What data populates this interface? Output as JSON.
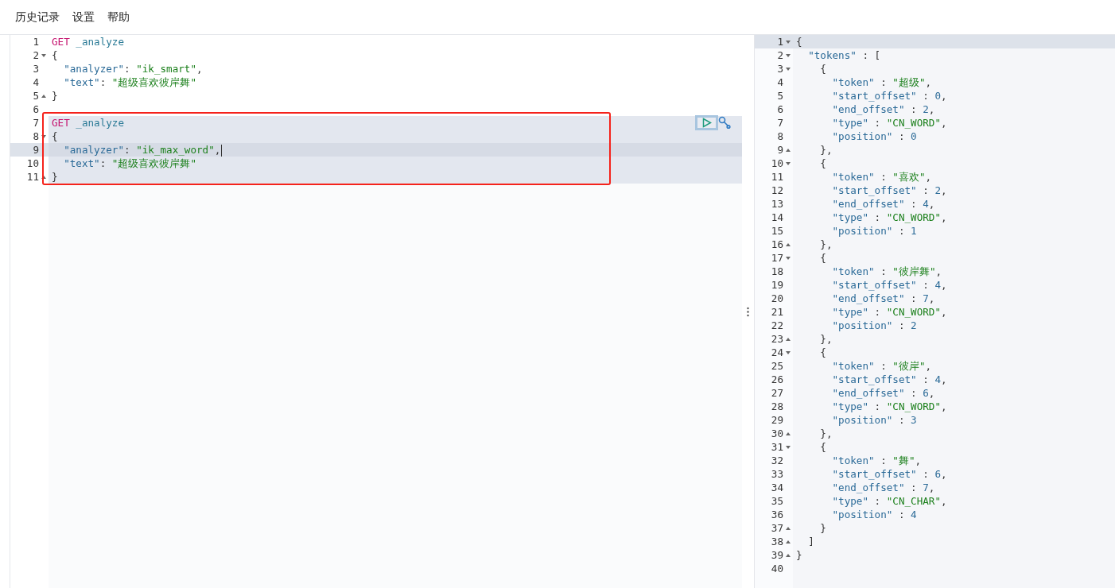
{
  "menu": [
    "历史记录",
    "设置",
    "帮助"
  ],
  "request_editor": {
    "annotation_box": true,
    "lines": [
      {
        "number": "1",
        "fold_start": false,
        "fold_end": false,
        "cursor": false,
        "in_request": false,
        "tokens": [
          {
            "kind": "method",
            "text": "GET"
          },
          {
            "kind": "path",
            "text": " _analyze"
          }
        ]
      },
      {
        "number": "2",
        "fold_start": true,
        "fold_end": false,
        "cursor": false,
        "in_request": false,
        "tokens": [
          {
            "kind": "punct",
            "text": "{"
          }
        ]
      },
      {
        "number": "3",
        "fold_start": false,
        "fold_end": false,
        "cursor": false,
        "in_request": false,
        "tokens": [
          {
            "kind": "key",
            "text": "  \"analyzer\""
          },
          {
            "kind": "punct",
            "text": ": "
          },
          {
            "kind": "string",
            "text": "\"ik_smart\""
          },
          {
            "kind": "punct",
            "text": ","
          }
        ]
      },
      {
        "number": "4",
        "fold_start": false,
        "fold_end": false,
        "cursor": false,
        "in_request": false,
        "tokens": [
          {
            "kind": "key",
            "text": "  \"text\""
          },
          {
            "kind": "punct",
            "text": ": "
          },
          {
            "kind": "string",
            "text": "\"超级喜欢彼岸舞\""
          }
        ]
      },
      {
        "number": "5",
        "fold_start": false,
        "fold_end": true,
        "cursor": false,
        "in_request": false,
        "tokens": [
          {
            "kind": "punct",
            "text": "}"
          }
        ]
      },
      {
        "number": "6",
        "fold_start": false,
        "fold_end": false,
        "cursor": false,
        "in_request": false
      },
      {
        "number": "7",
        "fold_start": false,
        "fold_end": false,
        "cursor": false,
        "in_request": true,
        "tokens": [
          {
            "kind": "method",
            "text": "GET"
          },
          {
            "kind": "path",
            "text": " _analyze"
          }
        ]
      },
      {
        "number": "8",
        "fold_start": true,
        "fold_end": false,
        "cursor": false,
        "in_request": true,
        "tokens": [
          {
            "kind": "punct",
            "text": "{"
          }
        ]
      },
      {
        "number": "9",
        "fold_start": false,
        "fold_end": false,
        "cursor": true,
        "in_request": true,
        "tokens": [
          {
            "kind": "key",
            "text": "  \"analyzer\""
          },
          {
            "kind": "punct",
            "text": ": "
          },
          {
            "kind": "string",
            "text": "\"ik_max_word\""
          },
          {
            "kind": "punct",
            "text": ","
          }
        ]
      },
      {
        "number": "10",
        "fold_start": false,
        "fold_end": false,
        "cursor": false,
        "in_request": true,
        "tokens": [
          {
            "kind": "key",
            "text": "  \"text\""
          },
          {
            "kind": "punct",
            "text": ": "
          },
          {
            "kind": "string",
            "text": "\"超级喜欢彼岸舞\""
          }
        ]
      },
      {
        "number": "11",
        "fold_start": false,
        "fold_end": true,
        "cursor": false,
        "in_request": true,
        "tokens": [
          {
            "kind": "punct",
            "text": "}"
          }
        ]
      }
    ]
  },
  "response_viewer": {
    "lines": [
      {
        "number": "1",
        "fold_start": true,
        "fold_end": false,
        "cursor": true,
        "tokens": [
          {
            "kind": "punct",
            "text": "{"
          }
        ]
      },
      {
        "number": "2",
        "fold_start": true,
        "fold_end": false,
        "cursor": false,
        "tokens": [
          {
            "kind": "key",
            "text": "  \"tokens\""
          },
          {
            "kind": "punct",
            "text": " : ["
          }
        ]
      },
      {
        "number": "3",
        "fold_start": true,
        "fold_end": false,
        "cursor": false,
        "tokens": [
          {
            "kind": "punct",
            "text": "    {"
          }
        ]
      },
      {
        "number": "4",
        "fold_start": false,
        "fold_end": false,
        "cursor": false,
        "tokens": [
          {
            "kind": "key",
            "text": "      \"token\""
          },
          {
            "kind": "punct",
            "text": " : "
          },
          {
            "kind": "string",
            "text": "\"超级\""
          },
          {
            "kind": "punct",
            "text": ","
          }
        ]
      },
      {
        "number": "5",
        "fold_start": false,
        "fold_end": false,
        "cursor": false,
        "tokens": [
          {
            "kind": "key",
            "text": "      \"start_offset\""
          },
          {
            "kind": "punct",
            "text": " : "
          },
          {
            "kind": "number",
            "text": "0"
          },
          {
            "kind": "punct",
            "text": ","
          }
        ]
      },
      {
        "number": "6",
        "fold_start": false,
        "fold_end": false,
        "cursor": false,
        "tokens": [
          {
            "kind": "key",
            "text": "      \"end_offset\""
          },
          {
            "kind": "punct",
            "text": " : "
          },
          {
            "kind": "number",
            "text": "2"
          },
          {
            "kind": "punct",
            "text": ","
          }
        ]
      },
      {
        "number": "7",
        "fold_start": false,
        "fold_end": false,
        "cursor": false,
        "tokens": [
          {
            "kind": "key",
            "text": "      \"type\""
          },
          {
            "kind": "punct",
            "text": " : "
          },
          {
            "kind": "string",
            "text": "\"CN_WORD\""
          },
          {
            "kind": "punct",
            "text": ","
          }
        ]
      },
      {
        "number": "8",
        "fold_start": false,
        "fold_end": false,
        "cursor": false,
        "tokens": [
          {
            "kind": "key",
            "text": "      \"position\""
          },
          {
            "kind": "punct",
            "text": " : "
          },
          {
            "kind": "number",
            "text": "0"
          }
        ]
      },
      {
        "number": "9",
        "fold_start": false,
        "fold_end": true,
        "cursor": false,
        "tokens": [
          {
            "kind": "punct",
            "text": "    },"
          }
        ]
      },
      {
        "number": "10",
        "fold_start": true,
        "fold_end": false,
        "cursor": false,
        "tokens": [
          {
            "kind": "punct",
            "text": "    {"
          }
        ]
      },
      {
        "number": "11",
        "fold_start": false,
        "fold_end": false,
        "cursor": false,
        "tokens": [
          {
            "kind": "key",
            "text": "      \"token\""
          },
          {
            "kind": "punct",
            "text": " : "
          },
          {
            "kind": "string",
            "text": "\"喜欢\""
          },
          {
            "kind": "punct",
            "text": ","
          }
        ]
      },
      {
        "number": "12",
        "fold_start": false,
        "fold_end": false,
        "cursor": false,
        "tokens": [
          {
            "kind": "key",
            "text": "      \"start_offset\""
          },
          {
            "kind": "punct",
            "text": " : "
          },
          {
            "kind": "number",
            "text": "2"
          },
          {
            "kind": "punct",
            "text": ","
          }
        ]
      },
      {
        "number": "13",
        "fold_start": false,
        "fold_end": false,
        "cursor": false,
        "tokens": [
          {
            "kind": "key",
            "text": "      \"end_offset\""
          },
          {
            "kind": "punct",
            "text": " : "
          },
          {
            "kind": "number",
            "text": "4"
          },
          {
            "kind": "punct",
            "text": ","
          }
        ]
      },
      {
        "number": "14",
        "fold_start": false,
        "fold_end": false,
        "cursor": false,
        "tokens": [
          {
            "kind": "key",
            "text": "      \"type\""
          },
          {
            "kind": "punct",
            "text": " : "
          },
          {
            "kind": "string",
            "text": "\"CN_WORD\""
          },
          {
            "kind": "punct",
            "text": ","
          }
        ]
      },
      {
        "number": "15",
        "fold_start": false,
        "fold_end": false,
        "cursor": false,
        "tokens": [
          {
            "kind": "key",
            "text": "      \"position\""
          },
          {
            "kind": "punct",
            "text": " : "
          },
          {
            "kind": "number",
            "text": "1"
          }
        ]
      },
      {
        "number": "16",
        "fold_start": false,
        "fold_end": true,
        "cursor": false,
        "tokens": [
          {
            "kind": "punct",
            "text": "    },"
          }
        ]
      },
      {
        "number": "17",
        "fold_start": true,
        "fold_end": false,
        "cursor": false,
        "tokens": [
          {
            "kind": "punct",
            "text": "    {"
          }
        ]
      },
      {
        "number": "18",
        "fold_start": false,
        "fold_end": false,
        "cursor": false,
        "tokens": [
          {
            "kind": "key",
            "text": "      \"token\""
          },
          {
            "kind": "punct",
            "text": " : "
          },
          {
            "kind": "string",
            "text": "\"彼岸舞\""
          },
          {
            "kind": "punct",
            "text": ","
          }
        ]
      },
      {
        "number": "19",
        "fold_start": false,
        "fold_end": false,
        "cursor": false,
        "tokens": [
          {
            "kind": "key",
            "text": "      \"start_offset\""
          },
          {
            "kind": "punct",
            "text": " : "
          },
          {
            "kind": "number",
            "text": "4"
          },
          {
            "kind": "punct",
            "text": ","
          }
        ]
      },
      {
        "number": "20",
        "fold_start": false,
        "fold_end": false,
        "cursor": false,
        "tokens": [
          {
            "kind": "key",
            "text": "      \"end_offset\""
          },
          {
            "kind": "punct",
            "text": " : "
          },
          {
            "kind": "number",
            "text": "7"
          },
          {
            "kind": "punct",
            "text": ","
          }
        ]
      },
      {
        "number": "21",
        "fold_start": false,
        "fold_end": false,
        "cursor": false,
        "tokens": [
          {
            "kind": "key",
            "text": "      \"type\""
          },
          {
            "kind": "punct",
            "text": " : "
          },
          {
            "kind": "string",
            "text": "\"CN_WORD\""
          },
          {
            "kind": "punct",
            "text": ","
          }
        ]
      },
      {
        "number": "22",
        "fold_start": false,
        "fold_end": false,
        "cursor": false,
        "tokens": [
          {
            "kind": "key",
            "text": "      \"position\""
          },
          {
            "kind": "punct",
            "text": " : "
          },
          {
            "kind": "number",
            "text": "2"
          }
        ]
      },
      {
        "number": "23",
        "fold_start": false,
        "fold_end": true,
        "cursor": false,
        "tokens": [
          {
            "kind": "punct",
            "text": "    },"
          }
        ]
      },
      {
        "number": "24",
        "fold_start": true,
        "fold_end": false,
        "cursor": false,
        "tokens": [
          {
            "kind": "punct",
            "text": "    {"
          }
        ]
      },
      {
        "number": "25",
        "fold_start": false,
        "fold_end": false,
        "cursor": false,
        "tokens": [
          {
            "kind": "key",
            "text": "      \"token\""
          },
          {
            "kind": "punct",
            "text": " : "
          },
          {
            "kind": "string",
            "text": "\"彼岸\""
          },
          {
            "kind": "punct",
            "text": ","
          }
        ]
      },
      {
        "number": "26",
        "fold_start": false,
        "fold_end": false,
        "cursor": false,
        "tokens": [
          {
            "kind": "key",
            "text": "      \"start_offset\""
          },
          {
            "kind": "punct",
            "text": " : "
          },
          {
            "kind": "number",
            "text": "4"
          },
          {
            "kind": "punct",
            "text": ","
          }
        ]
      },
      {
        "number": "27",
        "fold_start": false,
        "fold_end": false,
        "cursor": false,
        "tokens": [
          {
            "kind": "key",
            "text": "      \"end_offset\""
          },
          {
            "kind": "punct",
            "text": " : "
          },
          {
            "kind": "number",
            "text": "6"
          },
          {
            "kind": "punct",
            "text": ","
          }
        ]
      },
      {
        "number": "28",
        "fold_start": false,
        "fold_end": false,
        "cursor": false,
        "tokens": [
          {
            "kind": "key",
            "text": "      \"type\""
          },
          {
            "kind": "punct",
            "text": " : "
          },
          {
            "kind": "string",
            "text": "\"CN_WORD\""
          },
          {
            "kind": "punct",
            "text": ","
          }
        ]
      },
      {
        "number": "29",
        "fold_start": false,
        "fold_end": false,
        "cursor": false,
        "tokens": [
          {
            "kind": "key",
            "text": "      \"position\""
          },
          {
            "kind": "punct",
            "text": " : "
          },
          {
            "kind": "number",
            "text": "3"
          }
        ]
      },
      {
        "number": "30",
        "fold_start": false,
        "fold_end": true,
        "cursor": false,
        "tokens": [
          {
            "kind": "punct",
            "text": "    },"
          }
        ]
      },
      {
        "number": "31",
        "fold_start": true,
        "fold_end": false,
        "cursor": false,
        "tokens": [
          {
            "kind": "punct",
            "text": "    {"
          }
        ]
      },
      {
        "number": "32",
        "fold_start": false,
        "fold_end": false,
        "cursor": false,
        "tokens": [
          {
            "kind": "key",
            "text": "      \"token\""
          },
          {
            "kind": "punct",
            "text": " : "
          },
          {
            "kind": "string",
            "text": "\"舞\""
          },
          {
            "kind": "punct",
            "text": ","
          }
        ]
      },
      {
        "number": "33",
        "fold_start": false,
        "fold_end": false,
        "cursor": false,
        "tokens": [
          {
            "kind": "key",
            "text": "      \"start_offset\""
          },
          {
            "kind": "punct",
            "text": " : "
          },
          {
            "kind": "number",
            "text": "6"
          },
          {
            "kind": "punct",
            "text": ","
          }
        ]
      },
      {
        "number": "34",
        "fold_start": false,
        "fold_end": false,
        "cursor": false,
        "tokens": [
          {
            "kind": "key",
            "text": "      \"end_offset\""
          },
          {
            "kind": "punct",
            "text": " : "
          },
          {
            "kind": "number",
            "text": "7"
          },
          {
            "kind": "punct",
            "text": ","
          }
        ]
      },
      {
        "number": "35",
        "fold_start": false,
        "fold_end": false,
        "cursor": false,
        "tokens": [
          {
            "kind": "key",
            "text": "      \"type\""
          },
          {
            "kind": "punct",
            "text": " : "
          },
          {
            "kind": "string",
            "text": "\"CN_CHAR\""
          },
          {
            "kind": "punct",
            "text": ","
          }
        ]
      },
      {
        "number": "36",
        "fold_start": false,
        "fold_end": false,
        "cursor": false,
        "tokens": [
          {
            "kind": "key",
            "text": "      \"position\""
          },
          {
            "kind": "punct",
            "text": " : "
          },
          {
            "kind": "number",
            "text": "4"
          }
        ]
      },
      {
        "number": "37",
        "fold_start": false,
        "fold_end": true,
        "cursor": false,
        "tokens": [
          {
            "kind": "punct",
            "text": "    }"
          }
        ]
      },
      {
        "number": "38",
        "fold_start": false,
        "fold_end": true,
        "cursor": false,
        "tokens": [
          {
            "kind": "punct",
            "text": "  ]"
          }
        ]
      },
      {
        "number": "39",
        "fold_start": false,
        "fold_end": true,
        "cursor": false,
        "tokens": [
          {
            "kind": "punct",
            "text": "}"
          }
        ]
      },
      {
        "number": "40",
        "fold_start": false,
        "fold_end": false,
        "cursor": false
      }
    ]
  }
}
